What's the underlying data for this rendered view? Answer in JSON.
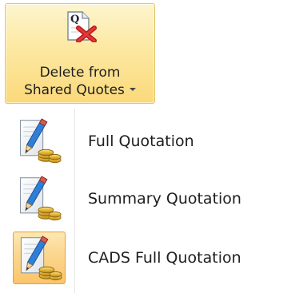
{
  "ribbon_button": {
    "label_line1": "Delete from",
    "label_line2": "Shared Quotes",
    "icon": "document-q-delete-icon",
    "accent_colors": [
      "#fde9a4",
      "#e5c365"
    ]
  },
  "menu": {
    "items": [
      {
        "label": "Full Quotation",
        "icon": "pencil-coins-icon",
        "highlighted": false
      },
      {
        "label": "Summary Quotation",
        "icon": "pencil-coins-icon",
        "highlighted": false
      },
      {
        "label": "CADS Full Quotation",
        "icon": "pencil-coins-icon",
        "highlighted": true
      }
    ],
    "highlight_color": "#fcd48a"
  },
  "doc_letter": "Q"
}
